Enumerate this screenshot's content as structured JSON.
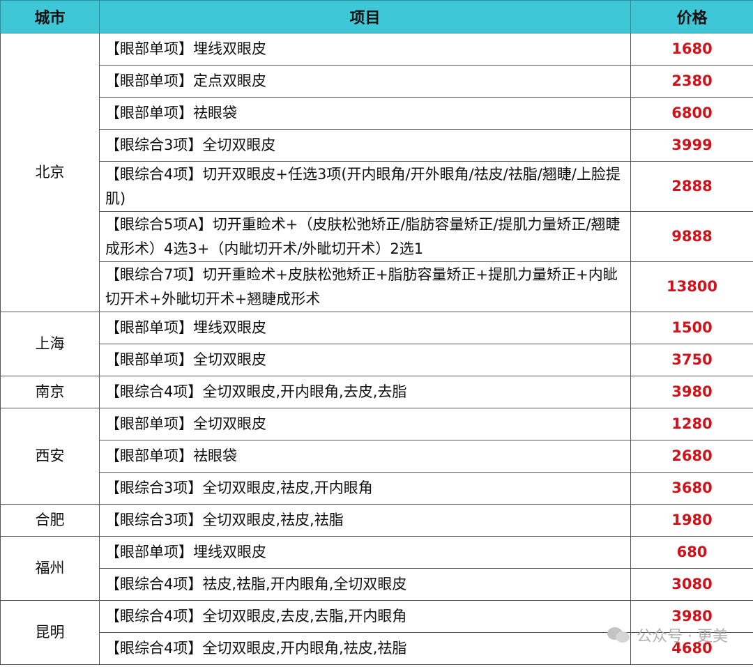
{
  "headers": {
    "city": "城市",
    "item": "项目",
    "price": "价格"
  },
  "rows": [
    {
      "city": "北京",
      "item": "【眼部单项】埋线双眼皮",
      "price": "1680"
    },
    {
      "item": "【眼部单项】定点双眼皮",
      "price": "2380"
    },
    {
      "item": "【眼部单项】祛眼袋",
      "price": "6800"
    },
    {
      "item": "【眼综合3项】全切双眼皮",
      "price": "3999"
    },
    {
      "item": "【眼综合4项】切开双眼皮+任选3项(开内眼角/开外眼角/祛皮/祛脂/翘睫/上脸提肌)",
      "price": "2888"
    },
    {
      "item": "【眼综合5项A】切开重睑术+（皮肤松弛矫正/脂肪容量矫正/提肌力量矫正/翘睫成形术）4选3+（内眦切开术/外眦切开术）2选1",
      "price": "9888"
    },
    {
      "item": "【眼综合7项】切开重睑术+皮肤松弛矫正+脂肪容量矫正+提肌力量矫正+内眦切开术+外眦切开术+翘睫成形术",
      "price": "13800"
    },
    {
      "city": "上海",
      "item": "【眼部单项】埋线双眼皮",
      "price": "1500"
    },
    {
      "item": "【眼部单项】全切双眼皮",
      "price": "3750"
    },
    {
      "city": "南京",
      "item": "【眼综合4项】全切双眼皮,开内眼角,去皮,去脂",
      "price": "3980"
    },
    {
      "city": "西安",
      "item": "【眼部单项】全切双眼皮",
      "price": "1280"
    },
    {
      "item": "【眼部单项】祛眼袋",
      "price": "2680"
    },
    {
      "item": "【眼综合3项】全切双眼皮,祛皮,开内眼角",
      "price": "3680"
    },
    {
      "city": "合肥",
      "item": "【眼综合3项】全切双眼皮,祛皮,祛脂",
      "price": "1980"
    },
    {
      "city": "福州",
      "item": "【眼部单项】埋线双眼皮",
      "price": "680"
    },
    {
      "item": "【眼综合4项】祛皮,祛脂,开内眼角,全切双眼皮",
      "price": "3080"
    },
    {
      "city": "昆明",
      "item": "【眼综合4项】全切双眼皮,去皮,去脂,开内眼角",
      "price": "3980"
    },
    {
      "item": "【眼综合4项】全切双眼皮,开内眼角,祛皮,祛脂",
      "price": "4680"
    }
  ],
  "watermark": {
    "text": "公众号 · 更美",
    "icon": "wechat-icon"
  },
  "colors": {
    "header_bg": "#3ec7d7",
    "price": "#d0121b"
  }
}
